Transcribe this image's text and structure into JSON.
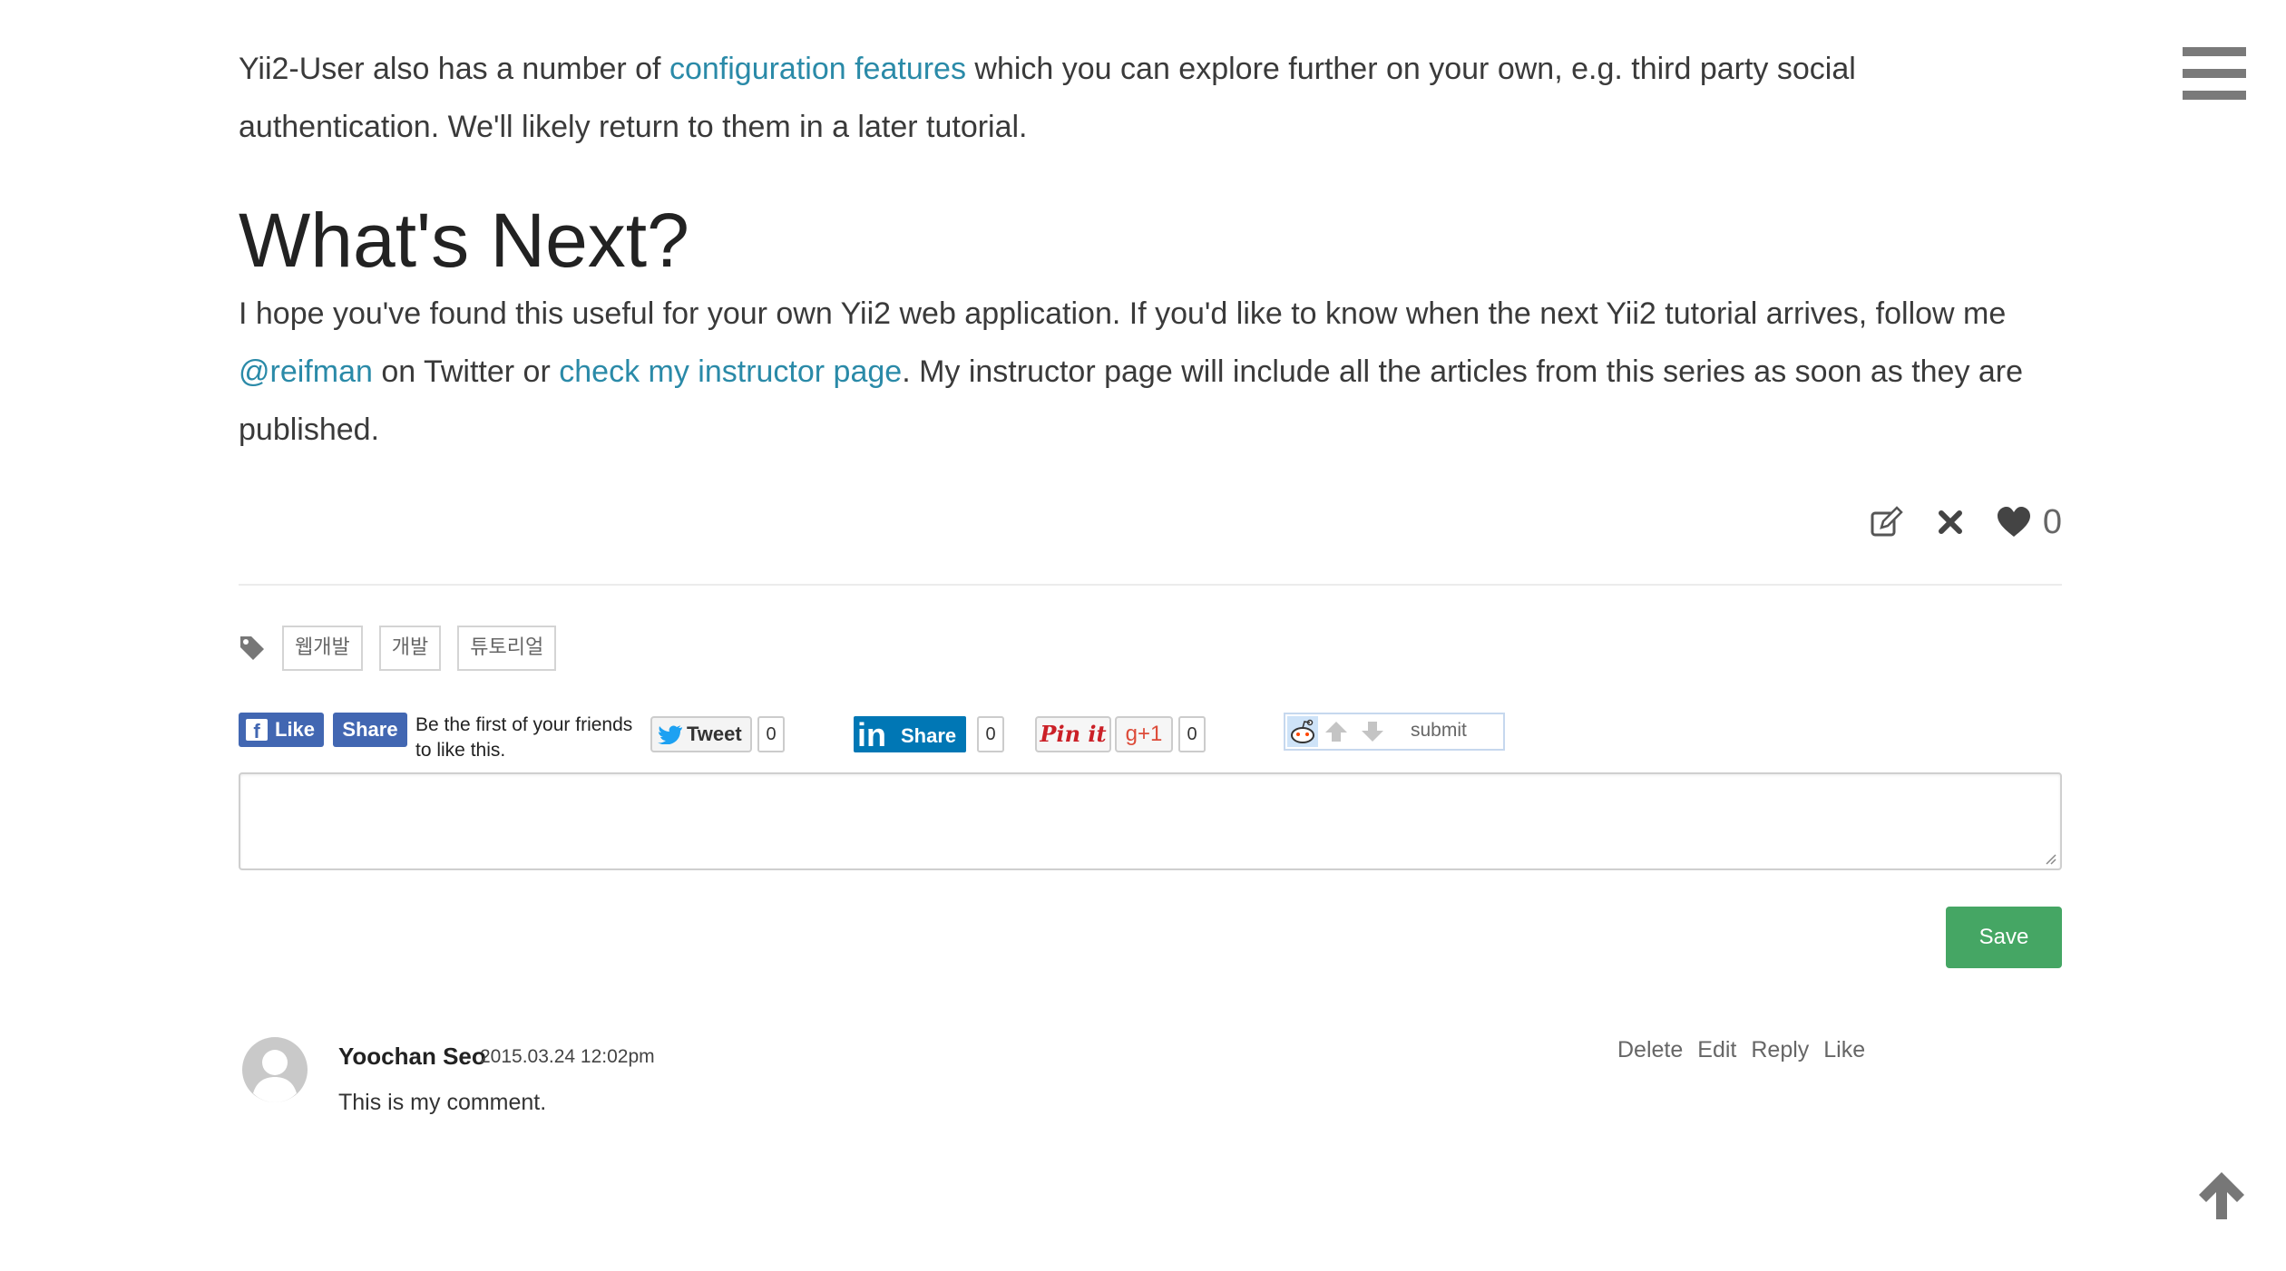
{
  "article": {
    "p1_a": "Yii2-User also has a number of ",
    "p1_link": "configuration features",
    "p1_b": " which you can explore further on your own, e.g. third party social authentication. We'll likely return to them in a later tutorial.",
    "heading": "What's Next?",
    "p2_a": "I hope you've found this useful for your own Yii2 web application. If you'd like to know when the next Yii2 tutorial arrives, follow me ",
    "p2_link1": "@reifman",
    "p2_b": " on Twitter or ",
    "p2_link2": "check my instructor page",
    "p2_c": ". My instructor page will include all the articles from this series as soon as they are published."
  },
  "post_actions": {
    "like_count": "0",
    "icons": [
      "edit-icon",
      "close-icon",
      "heart-icon"
    ]
  },
  "tags": [
    "웹개발",
    "개발",
    "튜토리얼"
  ],
  "social": {
    "fb_like": "Like",
    "fb_share": "Share",
    "fb_text": "Be the first of your friends to like this.",
    "tweet": "Tweet",
    "tweet_count": "0",
    "linkedin_share": "Share",
    "linkedin_count": "0",
    "pinit": "Pin it",
    "gplus": "g+1",
    "gplus_count": "0",
    "reddit_submit": "submit"
  },
  "comment_form": {
    "placeholder": "",
    "save_label": "Save"
  },
  "comments": [
    {
      "author": "Yoochan Seo",
      "date": "2015.03.24 12:02pm",
      "body": "This is my comment.",
      "actions": [
        "Delete",
        "Edit",
        "Reply",
        "Like"
      ]
    }
  ],
  "colors": {
    "link": "#2a8aa8",
    "save": "#45a664",
    "facebook": "#4267b2",
    "linkedin": "#0077b5",
    "pinterest": "#cb2027",
    "gplus": "#dd4b39"
  }
}
